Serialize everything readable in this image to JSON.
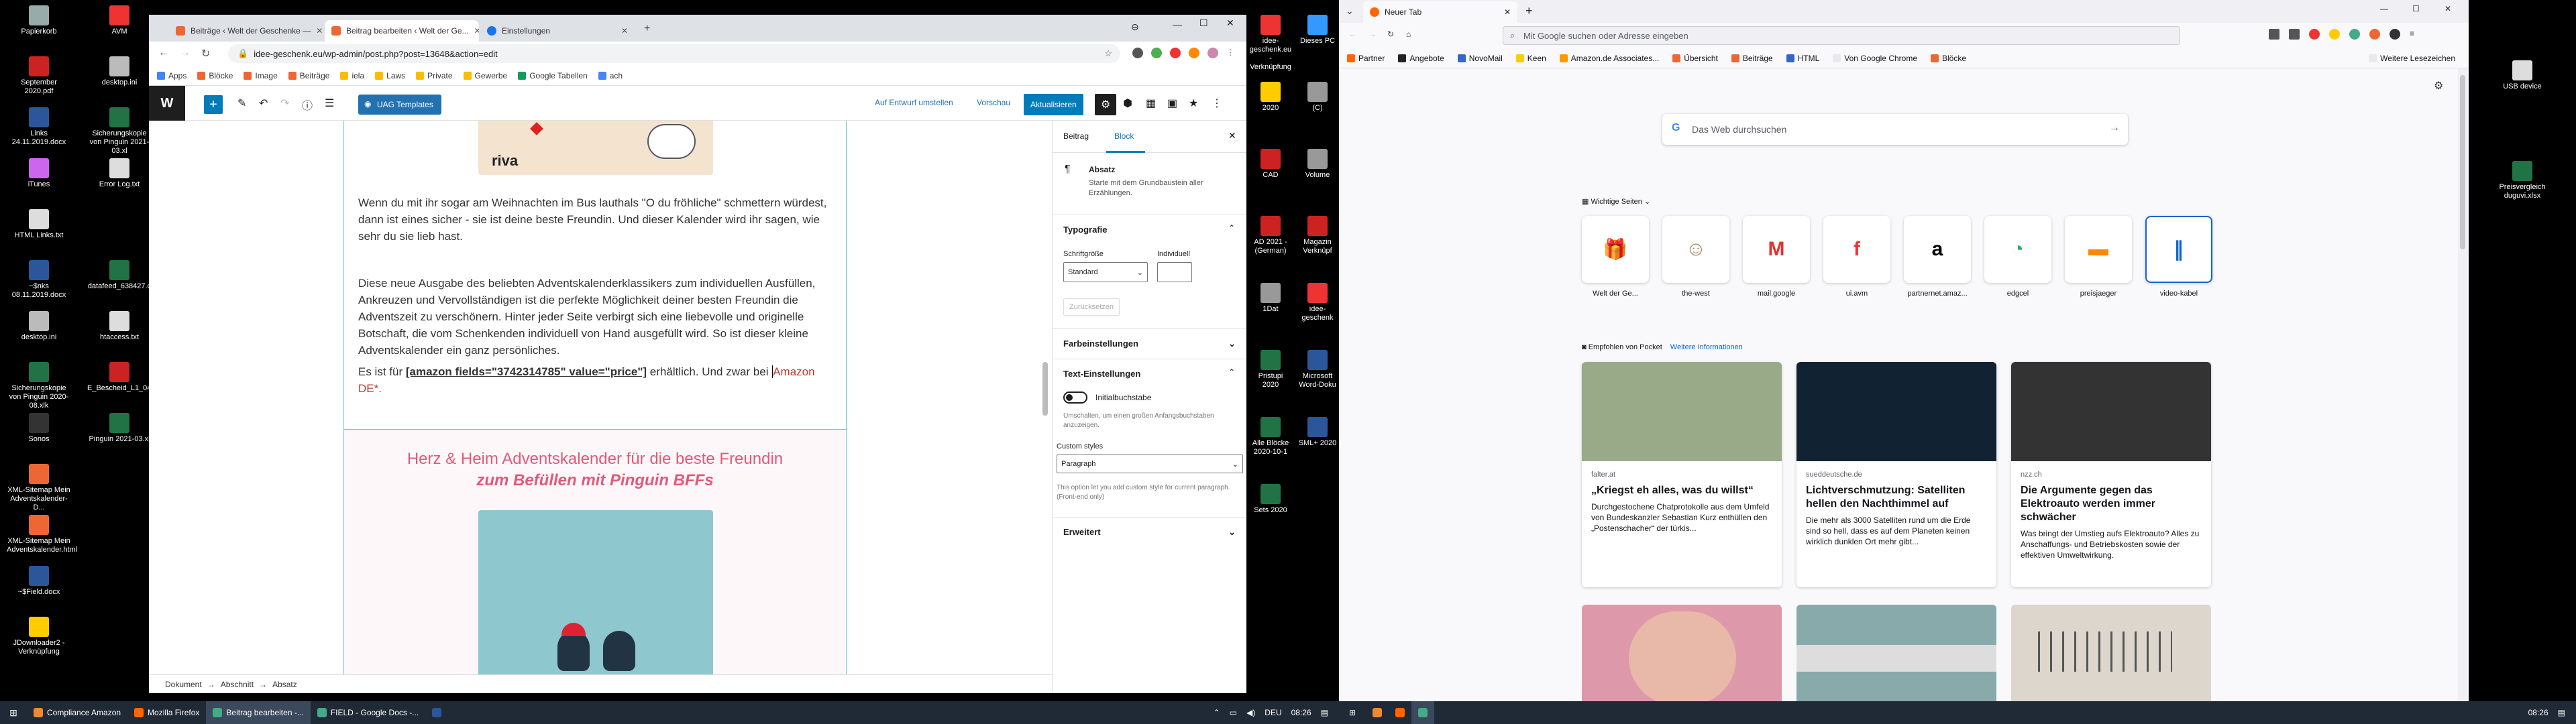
{
  "desktop_left": [
    {
      "label": "Papierkorb",
      "color": "#9aa"
    },
    {
      "label": "AVM",
      "color": "#e33"
    },
    {
      "label": "September 2020.pdf",
      "color": "#c22"
    },
    {
      "label": "desktop.ini",
      "color": "#bbb"
    },
    {
      "label": "Links 24.11.2019.docx",
      "color": "#2b579a"
    },
    {
      "label": "Sicherungskopie von Pinguin 2021-03.xl",
      "color": "#217346"
    },
    {
      "label": "iTunes",
      "color": "#c6e"
    },
    {
      "label": "Error Log.txt",
      "color": "#ddd"
    },
    {
      "label": "HTML Links.txt",
      "color": "#ddd"
    },
    {
      "label": "~$nks 08.11.2019.docx",
      "color": "#2b579a"
    },
    {
      "label": "datafeed_638427.c",
      "color": "#217346"
    },
    {
      "label": "desktop.ini",
      "color": "#bbb"
    },
    {
      "label": "htaccess.txt",
      "color": "#ddd"
    },
    {
      "label": "Sicherungskopie von Pinguin 2020-08.xlk",
      "color": "#217346"
    },
    {
      "label": "E_Bescheid_L1_04_",
      "color": "#c22"
    },
    {
      "label": "Sonos",
      "color": "#333"
    },
    {
      "label": "Pinguin 2021-03.xl",
      "color": "#217346"
    },
    {
      "label": "XML-Sitemap Mein Adventskalender-D...",
      "color": "#e63"
    },
    {
      "label": "XML-Sitemap Mein Adventskalender.html",
      "color": "#e63"
    },
    {
      "label": "~$Field.docx",
      "color": "#2b579a"
    },
    {
      "label": "JDownloader2 - Verknüpfung",
      "color": "#fc0"
    }
  ],
  "desktop_mid": [
    {
      "label": "idee-geschenk.eu - Verknüpfung",
      "color": "#e33"
    },
    {
      "label": "Dieses PC",
      "color": "#39f"
    },
    {
      "label": "2020",
      "color": "#fc0"
    },
    {
      "label": "(C)",
      "color": "#999"
    },
    {
      "label": "CAD",
      "color": "#c22"
    },
    {
      "label": "Volume",
      "color": "#999"
    },
    {
      "label": "AD 2021 - (German)",
      "color": "#c22"
    },
    {
      "label": "Magazin Verknüpf",
      "color": "#c22"
    },
    {
      "label": "1Dat",
      "color": "#999"
    },
    {
      "label": "idee-geschenk",
      "color": "#e33"
    },
    {
      "label": "Pristupi 2020",
      "color": "#217346"
    },
    {
      "label": "Microsoft Word-Doku",
      "color": "#2b579a"
    },
    {
      "label": "Alle Blöcke 2020-10-1",
      "color": "#217346"
    },
    {
      "label": "SML+ 2020",
      "color": "#2b579a"
    },
    {
      "label": "Sets 2020",
      "color": "#217346"
    }
  ],
  "desktop_right": [
    {
      "label": "USB device",
      "color": "#ddd"
    },
    {
      "label": "Preisvergleich duguvi.xlsx",
      "color": "#217346"
    }
  ],
  "chrome": {
    "tabs": [
      "Beiträge ‹ Welt der Geschenke —",
      "Beitrag bearbeiten ‹ Welt der Ge...",
      "Einstellungen"
    ],
    "url": "idee-geschenk.eu/wp-admin/post.php?post=13648&action=edit",
    "bookmarks": [
      "Apps",
      "Blöcke",
      "Image",
      "Beiträge",
      "iela",
      "Laws",
      "Private",
      "Gewerbe",
      "Google Tabellen",
      "ach"
    ]
  },
  "wp": {
    "uag_label": "UAG Templates",
    "draft_label": "Auf Entwurf umstellen",
    "preview_label": "Vorschau",
    "update_label": "Aktualisieren",
    "logo_text": "riva",
    "para1": "Wenn du mit ihr sogar am Weihnachten im Bus lauthals \"O du fröhliche\" schmettern würdest, dann ist eines sicher - sie ist deine beste Freundin. Und dieser Kalender wird ihr sagen, wie sehr du sie lieb hast.",
    "para2": "Diese neue Ausgabe des beliebten Adventskalenderklassikers zum individuellen Ausfüllen, Ankreuzen und Vervollständigen ist die perfekte Möglichkeit deiner besten Freundin die Adventszeit zu verschönern. Hinter jeder Seite verbirgt sich eine liebevolle und originelle Botschaft, die vom Schenkenden individuell von Hand ausgefüllt wird. So ist dieser kleine Adventskalender ein ganz persönliches.",
    "para3_pre": "Es ist für ",
    "para3_code": "[amazon fields=\"3742314785\" value=\"price\"]",
    "para3_mid": " erhältlich. Und zwar bei ",
    "para3_link": "Amazon DE",
    "para3_end": "*.",
    "heading_line1": "Herz & Heim Adventskalender für die beste Freundin",
    "heading_line2": "zum Befüllen mit Pinguin BFFs",
    "breadcrumb": [
      "Dokument",
      "Abschnitt",
      "Absatz"
    ],
    "sidebar": {
      "tab_post": "Beitrag",
      "tab_block": "Block",
      "block_name": "Absatz",
      "block_desc": "Starte mit dem Grundbaustein aller Erzählungen.",
      "typo": "Typografie",
      "font_size": "Schriftgröße",
      "custom": "Individuell",
      "font_default": "Standard",
      "reset": "Zurücksetzen",
      "colors": "Farbeinstellungen",
      "text_settings": "Text-Einstellungen",
      "dropcap": "Initialbuchstabe",
      "dropcap_help": "Umschalten, um einen großen Anfangsbuchstaben anzuzeigen.",
      "custom_styles": "Custom styles",
      "style_value": "Paragraph",
      "style_help": "This option let you add custom style for current paragraph. (Front-end only)",
      "advanced": "Erweitert"
    }
  },
  "firefox": {
    "tab": "Neuer Tab",
    "url_placeholder": "Mit Google suchen oder Adresse eingeben",
    "bookmarks": [
      "Partner",
      "Angebote",
      "NovoMail",
      "Keen",
      "Amazon.de Associates...",
      "Übersicht",
      "Beiträge",
      "HTML",
      "Von Google Chrome",
      "Blöcke"
    ],
    "more_bookmarks": "Weitere Lesezeichen",
    "search_placeholder": "Das Web durchsuchen",
    "top_sites_label": "Wichtige Seiten",
    "sites": [
      {
        "label": "Welt der Ge...",
        "color": "#e63",
        "glyph": "🎁"
      },
      {
        "label": "the-west",
        "color": "#a86",
        "glyph": "☺"
      },
      {
        "label": "mail.google",
        "color": "#d33",
        "glyph": "M"
      },
      {
        "label": "ui.avm",
        "color": "#e33",
        "glyph": "f"
      },
      {
        "label": "partnernet.amaz...",
        "color": "#000",
        "glyph": "a"
      },
      {
        "label": "edgcel",
        "color": "#3a6",
        "glyph": "◔"
      },
      {
        "label": "preisjaeger",
        "color": "#f80",
        "glyph": "▬"
      },
      {
        "label": "video-kabel",
        "color": "#16c",
        "glyph": "∥"
      }
    ],
    "pocket_label": "Empfohlen von Pocket",
    "pocket_more": "Weitere Informationen",
    "cards": [
      {
        "source": "falter.at",
        "title": "„Kriegst eh alles, was du willst“",
        "excerpt": "Durchgestochene Chatprotokolle aus dem Umfeld von Bundeskanzler Sebastian Kurz enthüllen den „Postenschacher“ der türkis...",
        "color": "#9a8"
      },
      {
        "source": "sueddeutsche.de",
        "title": "Lichtverschmutzung: Satelliten hellen den Nachthimmel auf",
        "excerpt": "Die mehr als 3000 Satelliten rund um die Erde sind so hell, dass es auf dem Planeten keinen wirklich dunklen Ort mehr gibt...",
        "color": "#123"
      },
      {
        "source": "nzz.ch",
        "title": "Die Argumente gegen das Elektroauto werden immer schwächer",
        "excerpt": "Was bringt der Umstieg aufs Elektroauto? Alles zu Anschaffungs- und Betriebskosten sowie der effektiven Umweltwirkung.",
        "color": "#333"
      }
    ]
  },
  "taskbar_left": [
    {
      "label": "Compliance Amazon",
      "color": "#e83"
    },
    {
      "label": "Mozilla Firefox",
      "color": "#f60"
    },
    {
      "label": "Beitrag bearbeiten -...",
      "color": "#4a8"
    },
    {
      "label": "FIELD - Google Docs -...",
      "color": "#4a8"
    }
  ],
  "clock_left": "08:26",
  "lang": "DEU",
  "clock_right": "08:26"
}
